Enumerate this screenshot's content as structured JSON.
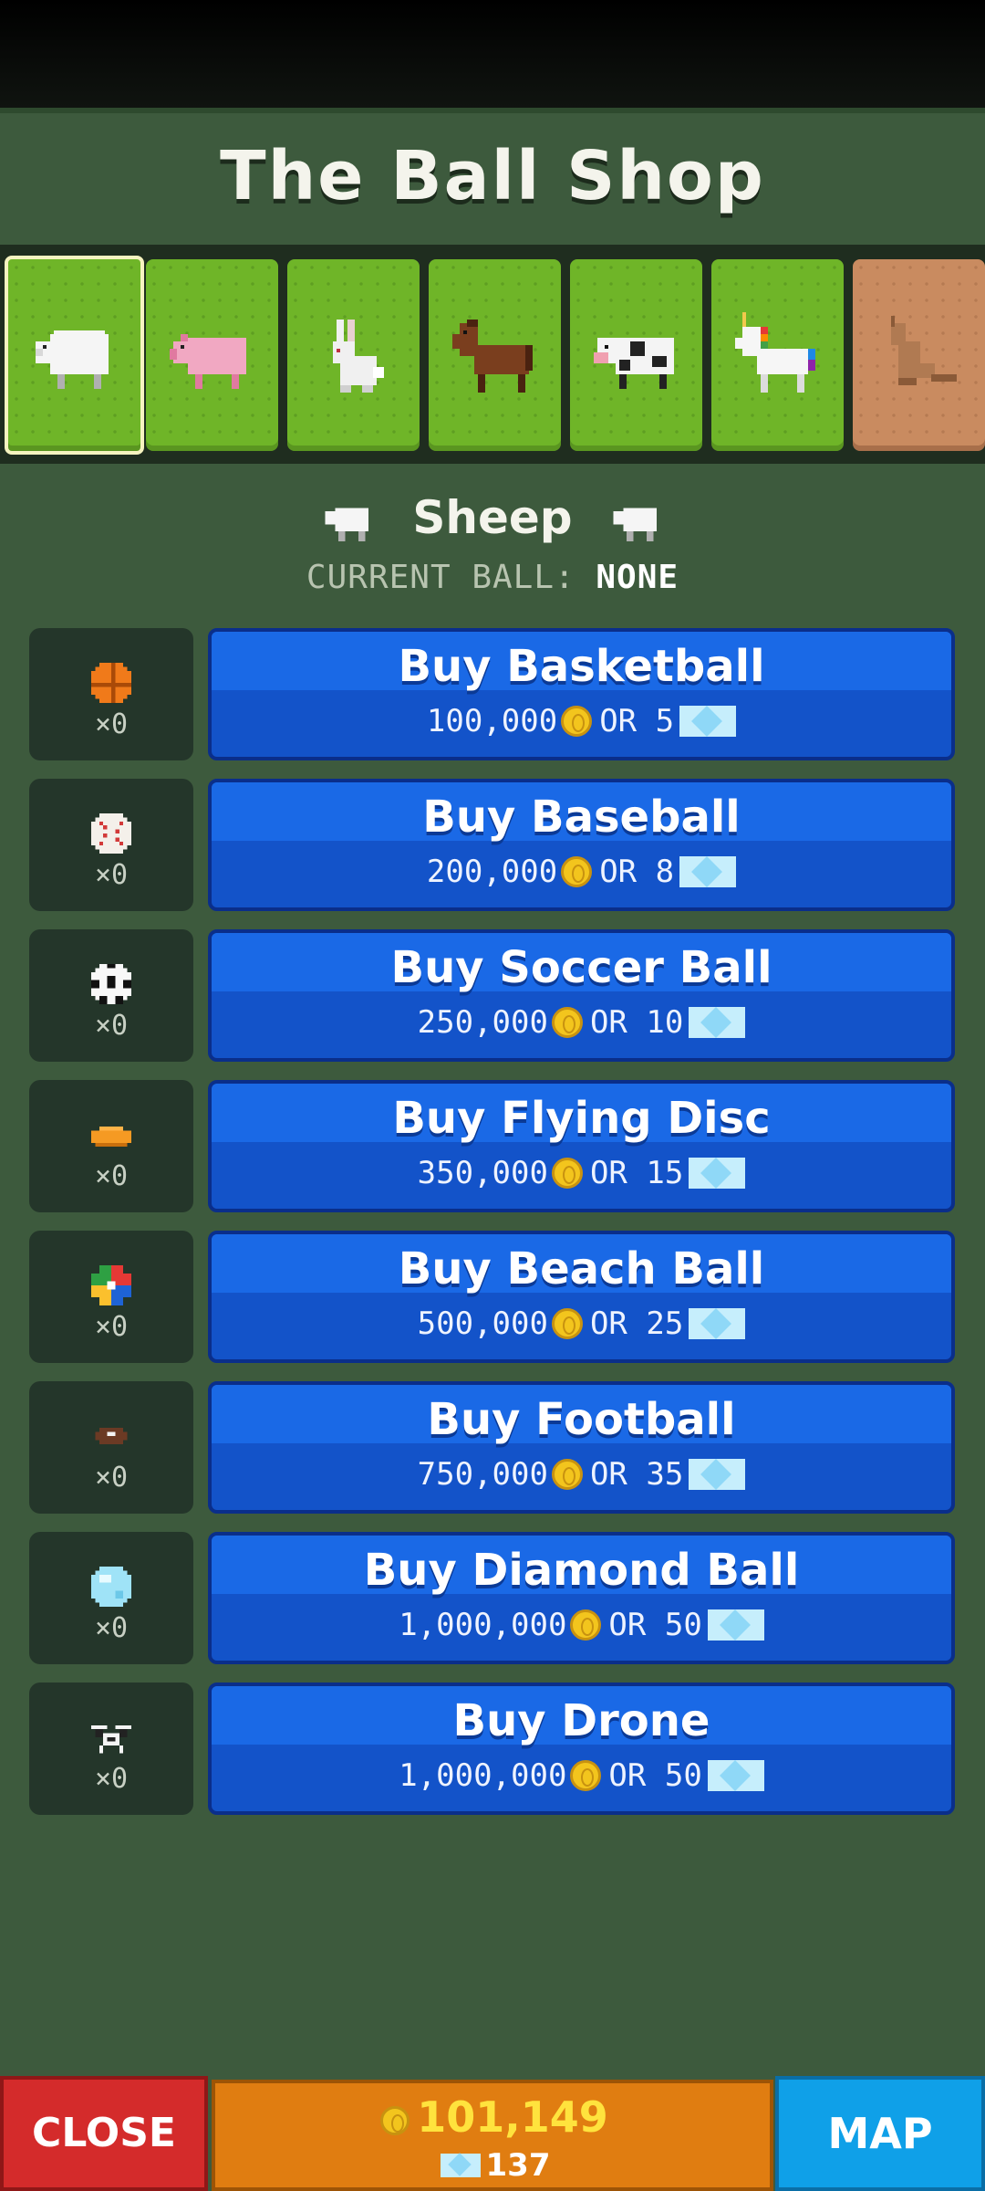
{
  "header": {
    "title": "The Ball Shop"
  },
  "animal_tabs": [
    {
      "icon": "sheep-icon",
      "selected": true,
      "locked": false
    },
    {
      "icon": "pig-icon",
      "selected": false,
      "locked": false
    },
    {
      "icon": "rabbit-icon",
      "selected": false,
      "locked": false
    },
    {
      "icon": "horse-icon",
      "selected": false,
      "locked": false
    },
    {
      "icon": "cow-icon",
      "selected": false,
      "locked": false
    },
    {
      "icon": "unicorn-icon",
      "selected": false,
      "locked": false
    },
    {
      "icon": "kangaroo-icon",
      "selected": false,
      "locked": true
    }
  ],
  "animal": {
    "name": "Sheep",
    "current_ball_label": "CURRENT BALL:",
    "current_ball_value": "NONE"
  },
  "items": [
    {
      "icon": "basketball-icon",
      "count": "×0",
      "label": "Buy Basketball",
      "coins": "100,000",
      "or": "OR",
      "gems": "5"
    },
    {
      "icon": "baseball-icon",
      "count": "×0",
      "label": "Buy Baseball",
      "coins": "200,000",
      "or": "OR",
      "gems": "8"
    },
    {
      "icon": "soccer-ball-icon",
      "count": "×0",
      "label": "Buy Soccer Ball",
      "coins": "250,000",
      "or": "OR",
      "gems": "10"
    },
    {
      "icon": "flying-disc-icon",
      "count": "×0",
      "label": "Buy Flying Disc",
      "coins": "350,000",
      "or": "OR",
      "gems": "15"
    },
    {
      "icon": "beach-ball-icon",
      "count": "×0",
      "label": "Buy Beach Ball",
      "coins": "500,000",
      "or": "OR",
      "gems": "25"
    },
    {
      "icon": "football-icon",
      "count": "×0",
      "label": "Buy Football",
      "coins": "750,000",
      "or": "OR",
      "gems": "35"
    },
    {
      "icon": "diamond-ball-icon",
      "count": "×0",
      "label": "Buy Diamond Ball",
      "coins": "1,000,000",
      "or": "OR",
      "gems": "50"
    },
    {
      "icon": "drone-icon",
      "count": "×0",
      "label": "Buy Drone",
      "coins": "1,000,000",
      "or": "OR",
      "gems": "50"
    }
  ],
  "footer": {
    "close_label": "CLOSE",
    "coins": "101,149",
    "gems": "137",
    "map_label": "MAP"
  }
}
